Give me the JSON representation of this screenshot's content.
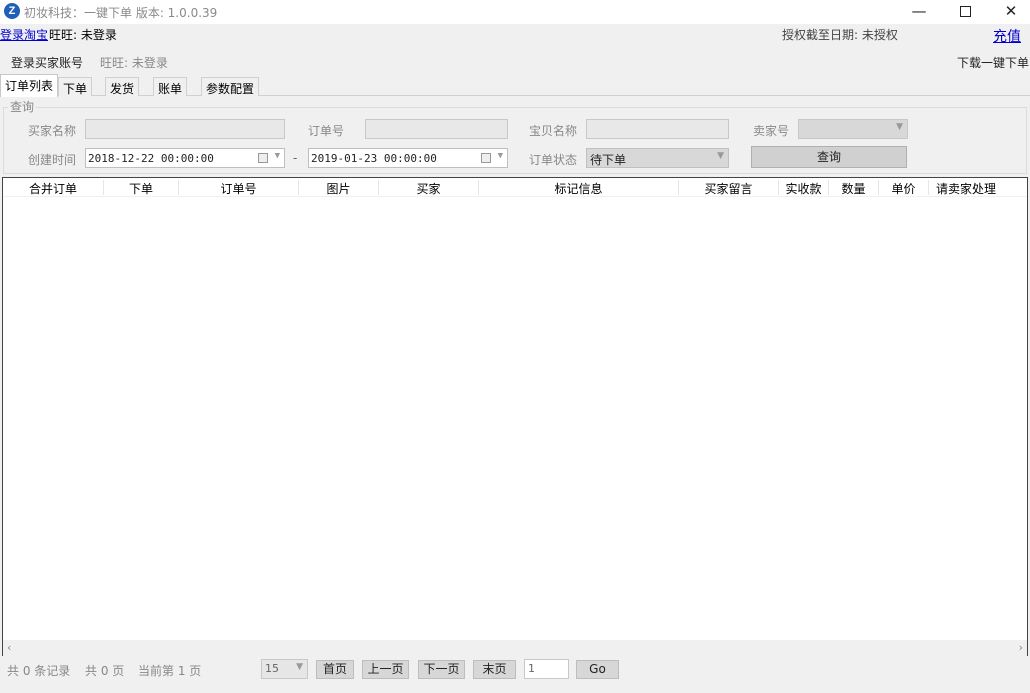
{
  "window": {
    "title": "初妆科技：一键下单    版本: 1.0.0.39",
    "icon_letter": "Z",
    "minimize": "—",
    "close": "✕"
  },
  "topbar": {
    "login_taobao": "登录淘宝",
    "wangwang_status": "旺旺: 未登录",
    "auth_label": "授权截至日期: 未授权",
    "recharge": "充值",
    "login_buyer": "登录买家账号",
    "wangwang2": "旺旺: 未登录",
    "download_order": "下载一键下单"
  },
  "tabs": [
    {
      "label": "订单列表"
    },
    {
      "label": "下单"
    },
    {
      "label": "发货"
    },
    {
      "label": "账单"
    },
    {
      "label": "参数配置"
    }
  ],
  "query": {
    "legend": "查询",
    "buyer_name_label": "买家名称",
    "buyer_name_value": "",
    "order_no_label": "订单号",
    "order_no_value": "",
    "item_name_label": "宝贝名称",
    "item_name_value": "",
    "seller_no_label": "卖家号",
    "seller_no_value": "",
    "created_label": "创建时间",
    "date_from": "2018-12-22 00:00:00",
    "date_sep": "-",
    "date_to": "2019-01-23 00:00:00",
    "status_label": "订单状态",
    "status_value": "待下单",
    "query_button": "查询"
  },
  "grid": {
    "columns": [
      "合并订单",
      "下单",
      "订单号",
      "图片",
      "买家",
      "标记信息",
      "买家留言",
      "实收款",
      "数量",
      "单价",
      "请卖家处理"
    ],
    "rows": []
  },
  "pager": {
    "total_records": "共 0 条记录",
    "total_pages": "共 0 页",
    "current_page": "当前第 1 页",
    "page_size": "15",
    "first": "首页",
    "prev": "上一页",
    "next": "下一页",
    "last": "末页",
    "page_input": "1",
    "go": "Go"
  }
}
